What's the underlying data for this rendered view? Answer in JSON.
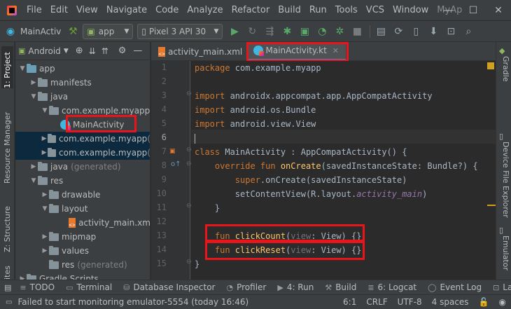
{
  "menu": [
    "File",
    "Edit",
    "View",
    "Navigate",
    "Code",
    "Analyze",
    "Refactor",
    "Build",
    "Run",
    "Tools",
    "VCS",
    "Window",
    "MyAp"
  ],
  "toolbar": {
    "breadcrumb": "MainActiv",
    "module": "app",
    "device": "Pixel 3 API 30"
  },
  "left_strip": {
    "project": "1: Project",
    "resource_manager": "Resource Manager",
    "structure": "Z: Structure",
    "favorites": "ites"
  },
  "right_strip": {
    "gradle": "Gradle",
    "device_file_explorer": "Device File Explorer",
    "emulator": "Emulator"
  },
  "project_panel": {
    "view": "Android",
    "tree": [
      {
        "label": "app",
        "gen": ""
      },
      {
        "label": "manifests",
        "gen": ""
      },
      {
        "label": "java",
        "gen": ""
      },
      {
        "label": "com.example.myapp",
        "gen": ""
      },
      {
        "label": "MainActivity",
        "gen": ""
      },
      {
        "label": "com.example.myapp",
        "gen": "("
      },
      {
        "label": "com.example.myapp",
        "gen": "("
      },
      {
        "label": "java",
        "gen": "(generated)"
      },
      {
        "label": "res",
        "gen": ""
      },
      {
        "label": "drawable",
        "gen": ""
      },
      {
        "label": "layout",
        "gen": ""
      },
      {
        "label": "activity_main.xml",
        "gen": ""
      },
      {
        "label": "mipmap",
        "gen": ""
      },
      {
        "label": "values",
        "gen": ""
      },
      {
        "label": "res",
        "gen": "(generated)"
      },
      {
        "label": "Gradle Scripts",
        "gen": ""
      }
    ]
  },
  "editor_tabs": [
    {
      "label": "activity_main.xml"
    },
    {
      "label": "MainActivity.kt"
    }
  ],
  "code": {
    "line_numbers": [
      "1",
      "2",
      "3",
      "4",
      "5",
      "6",
      "7",
      "8",
      "9",
      "10",
      "11",
      "12",
      "13",
      "14",
      "15"
    ],
    "l1_kw": "package",
    "l1_rest": " com.example.myapp",
    "l3_kw": "import",
    "l3_rest": " androidx.appcompat.app.AppCompatActivity",
    "l4_kw": "import",
    "l4_rest": " android.os.Bundle",
    "l5_kw": "import",
    "l5_rest": " android.view.View",
    "l7_kw": "class",
    "l7_rest": " MainActivity : AppCompatActivity() {",
    "l8_kw": "    override fun",
    "l8_fn": " onCreate",
    "l8_rest": "(savedInstanceState: Bundle?) {",
    "l9_kw": "        super",
    "l9_rest": ".onCreate(savedInstanceState)",
    "l10_a": "        setContentView(R.layout.",
    "l10_it": "activity_main",
    "l10_b": ")",
    "l11": "    }",
    "l13_kw": "    fun",
    "l13_fn": " clickCount",
    "l13_a": "(",
    "l13_param": "view",
    "l13_b": ": View) {}",
    "l14_kw": "    fun",
    "l14_fn": " clickReset",
    "l14_a": "(",
    "l14_param": "view",
    "l14_b": ": View) {}",
    "l15": "}"
  },
  "bottom_tools": [
    "TODO",
    "Terminal",
    "Database Inspector",
    "Profiler",
    "4: Run",
    "Build",
    "6: Logcat",
    "Event Log",
    "Layou"
  ],
  "status": {
    "message": "Failed to start monitoring emulator-5554 (today 16:46)",
    "position": "6:1",
    "line_sep": "CRLF",
    "encoding": "UTF-8",
    "indent": "4 spaces"
  },
  "colors": {
    "highlight_box": "#e8151b",
    "keyword": "#cc7832",
    "function": "#ffc66d"
  }
}
